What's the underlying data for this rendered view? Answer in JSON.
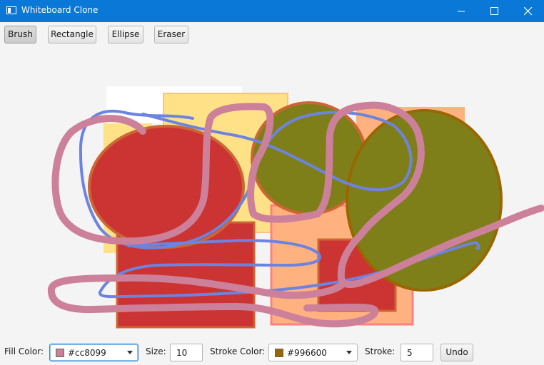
{
  "window": {
    "title": "Whiteboard Clone",
    "icon": "window-app-icon"
  },
  "window_controls": [
    "minimize-icon",
    "maximize-icon",
    "close-icon"
  ],
  "toolbar": {
    "brush_label": "Brush",
    "rectangle_label": "Rectangle",
    "ellipse_label": "Ellipse",
    "eraser_label": "Eraser",
    "active_tool": "Brush"
  },
  "bottom": {
    "fill_color_label": "Fill Color:",
    "fill_color_value": "#cc8099",
    "size_label": "Size:",
    "size_value": "10",
    "stroke_color_label": "Stroke Color:",
    "stroke_color_value": "#996600",
    "stroke_label": "Stroke:",
    "stroke_value": "5",
    "undo_label": "Undo"
  },
  "colors": {
    "titlebar": "#0a78d7",
    "pink_stroke": "#cc8099",
    "blue_stroke": "#6d83e0",
    "red_fill": "#cc3333",
    "olive_fill": "#7f7f1a",
    "yellow_fill": "#ffe287",
    "orange_fill": "#ffb27f"
  }
}
